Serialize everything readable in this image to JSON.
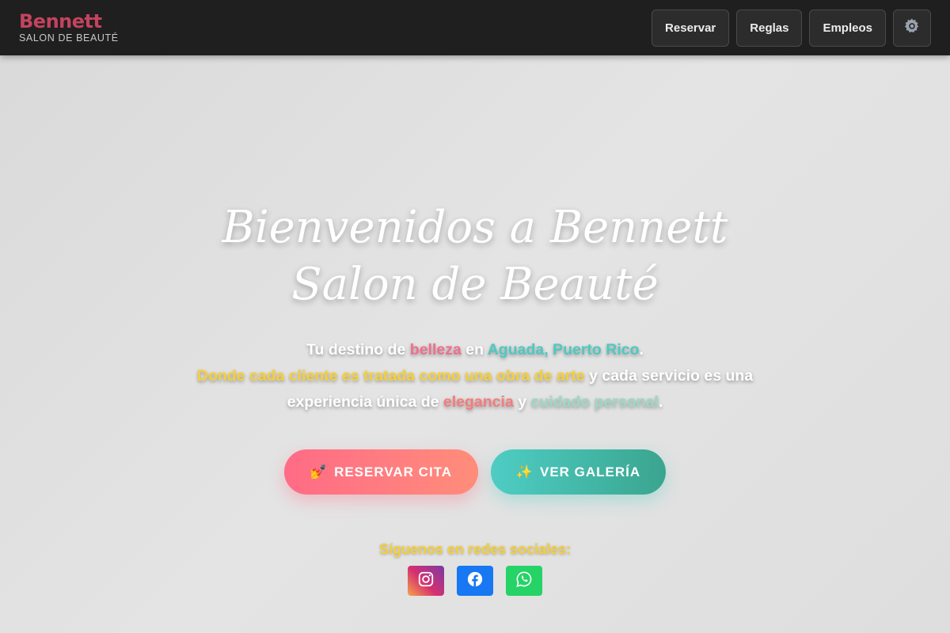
{
  "navbar": {
    "brand_name": "Bennett",
    "brand_sub": "SALON DE BEAUTÉ",
    "buttons": [
      {
        "label": "Reservar"
      },
      {
        "label": "Reglas"
      },
      {
        "label": "Empleos"
      }
    ],
    "settings_icon": "gear-icon"
  },
  "hero": {
    "title_line1": "Bienvenidos a Bennett",
    "title_line2": "Salon de Beauté",
    "text": {
      "p1_a": "Tu destino de ",
      "p1_hl1": "belleza",
      "p1_b": " en ",
      "p1_hl2": "Aguada, Puerto Rico",
      "p1_c": ".",
      "p2_hl": "Donde cada cliente es tratada como una obra de arte",
      "p2_a": " y cada servicio es una experiencia única de ",
      "p2_hl2": "elegancia",
      "p2_b": " y ",
      "p2_hl3": "cuidado personal",
      "p2_c": "."
    },
    "cta_book": {
      "icon": "💅",
      "label": "RESERVAR CITA"
    },
    "cta_gallery": {
      "icon": "✨",
      "label": "VER GALERÍA"
    },
    "social_label": "Síguenos en redes sociales:",
    "social_icons": [
      "instagram-icon",
      "facebook-icon",
      "whatsapp-icon"
    ]
  },
  "colors": {
    "brand": "#c4435f",
    "pink": "#f06f8c",
    "teal": "#4ec9c0",
    "yellow": "#f5cf3a"
  }
}
